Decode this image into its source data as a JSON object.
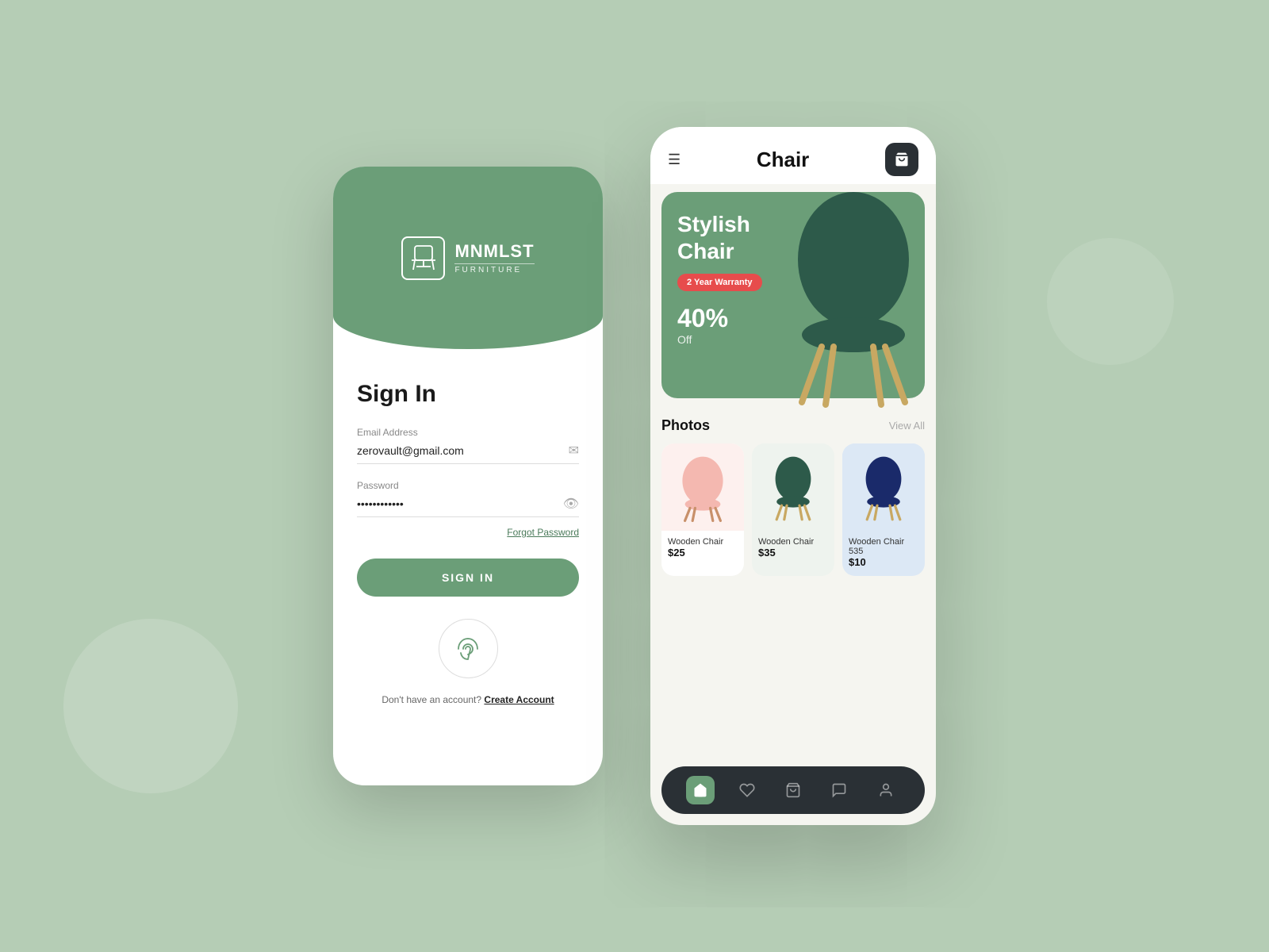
{
  "background": {
    "color": "#b5cdb5"
  },
  "signin_screen": {
    "logo": {
      "name": "MNMLST",
      "subtitle": "FURNITURE"
    },
    "title": "Sign In",
    "email_label": "Email Address",
    "email_value": "zerovault@gmail.com",
    "password_label": "Password",
    "password_value": "•••••••••••••",
    "forgot_password": "Forgot Password",
    "signin_button": "SIGN IN",
    "no_account_text": "Don't have an account?",
    "create_account": "Create Account"
  },
  "chair_screen": {
    "menu_icon": "☰",
    "title": "Chair",
    "cart_icon": "🛒",
    "hero": {
      "title_line1": "Stylish",
      "title_line2": "Chair",
      "warranty": "2 Year Warranty",
      "discount": "40%",
      "off_label": "Off"
    },
    "photos_title": "Photos",
    "view_all": "View All",
    "products": [
      {
        "name": "Wooden Chair",
        "price": "$25",
        "color": "pink"
      },
      {
        "name": "Wooden Chair",
        "price": "$35",
        "color": "dark-green"
      },
      {
        "name": "Wooden Chair 535",
        "price": "$10",
        "color": "navy"
      }
    ],
    "nav_items": [
      "home",
      "heart",
      "bag",
      "chat",
      "person"
    ],
    "thumbnails": [
      {
        "color": "#f4b8b0",
        "label": "pink chair"
      },
      {
        "color": "#2a4a3a",
        "label": "dark chair"
      },
      {
        "color": "#1a2a6a",
        "label": "navy chair"
      }
    ]
  }
}
